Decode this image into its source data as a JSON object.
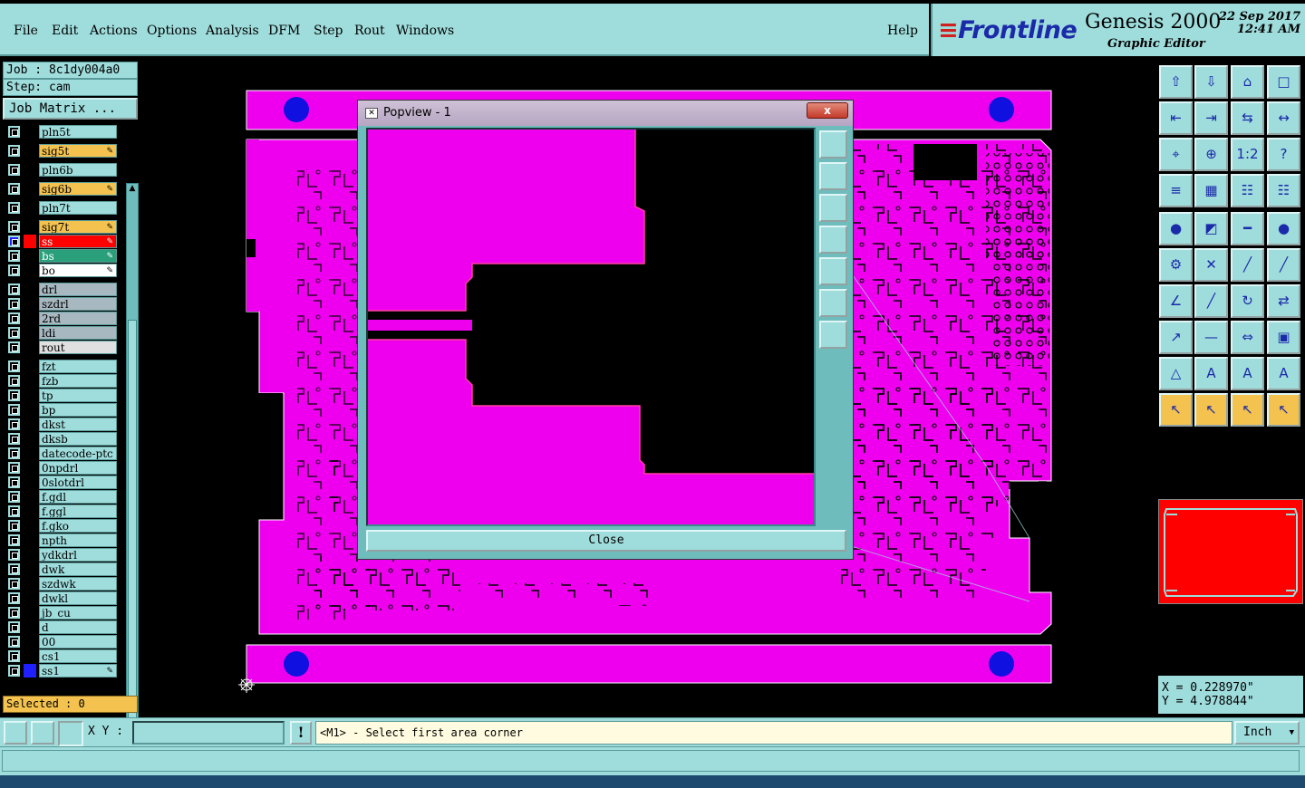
{
  "menubar": {
    "items": [
      "File",
      "Edit",
      "Actions",
      "Options",
      "Analysis",
      "DFM",
      "Step",
      "Rout",
      "Windows"
    ],
    "help": "Help"
  },
  "brand": {
    "logo": "Frontline",
    "product": "Genesis 2000",
    "subtitle": "Graphic Editor",
    "date": "22 Sep 2017",
    "time": "12:41 AM"
  },
  "job": {
    "job_label": "Job : 8c1dy004a0",
    "step_label": "Step: cam",
    "matrix_button": "Job Matrix ..."
  },
  "layers": [
    {
      "name": "pln5t",
      "state": "off"
    },
    {
      "name": "sig5t",
      "state": "board"
    },
    {
      "name": "pln6b",
      "state": "off"
    },
    {
      "name": "sig6b",
      "state": "board"
    },
    {
      "name": "pln7t",
      "state": "off"
    },
    {
      "name": "sig7t",
      "state": "board"
    },
    {
      "name": "ss",
      "state": "work"
    },
    {
      "name": "bs",
      "state": "green"
    },
    {
      "name": "bo",
      "state": "white"
    },
    {
      "name": "drl",
      "state": "gray"
    },
    {
      "name": "szdrl",
      "state": "gray"
    },
    {
      "name": "2rd",
      "state": "gray"
    },
    {
      "name": "ldi",
      "state": "gray"
    },
    {
      "name": "rout",
      "state": "light"
    },
    {
      "name": "fzt",
      "state": "off"
    },
    {
      "name": "fzb",
      "state": "off"
    },
    {
      "name": "tp",
      "state": "off"
    },
    {
      "name": "bp",
      "state": "off"
    },
    {
      "name": "dkst",
      "state": "off"
    },
    {
      "name": "dksb",
      "state": "off"
    },
    {
      "name": "datecode-ptc",
      "state": "off"
    },
    {
      "name": "0npdrl",
      "state": "off"
    },
    {
      "name": "0slotdrl",
      "state": "off"
    },
    {
      "name": "f.gdl",
      "state": "off"
    },
    {
      "name": "f.ggl",
      "state": "off"
    },
    {
      "name": "f.gko",
      "state": "off"
    },
    {
      "name": "npth",
      "state": "off"
    },
    {
      "name": "ydkdrl",
      "state": "off"
    },
    {
      "name": "dwk",
      "state": "off"
    },
    {
      "name": "szdwk",
      "state": "off"
    },
    {
      "name": "dwkl",
      "state": "off"
    },
    {
      "name": "jb_cu",
      "state": "off"
    },
    {
      "name": "d",
      "state": "off"
    },
    {
      "name": "00",
      "state": "off"
    },
    {
      "name": "cs1",
      "state": "off"
    },
    {
      "name": "ss1",
      "state": "blue"
    }
  ],
  "selected": "Selected : 0",
  "popview": {
    "title": "Popview - 1",
    "close_x": "x",
    "close_button": "Close"
  },
  "coords": {
    "x": "X = 0.228970\"",
    "y": "Y = 4.978844\""
  },
  "bottombar": {
    "xy_label": "X Y :",
    "xy_value": "",
    "prompt": "<M1> - Select first area corner",
    "units": "Inch"
  },
  "colors": {
    "panel": "#9fdcdc",
    "board": "#ee00ee",
    "accent_yellow": "#f3c24f",
    "work_layer": "#ff0000"
  }
}
